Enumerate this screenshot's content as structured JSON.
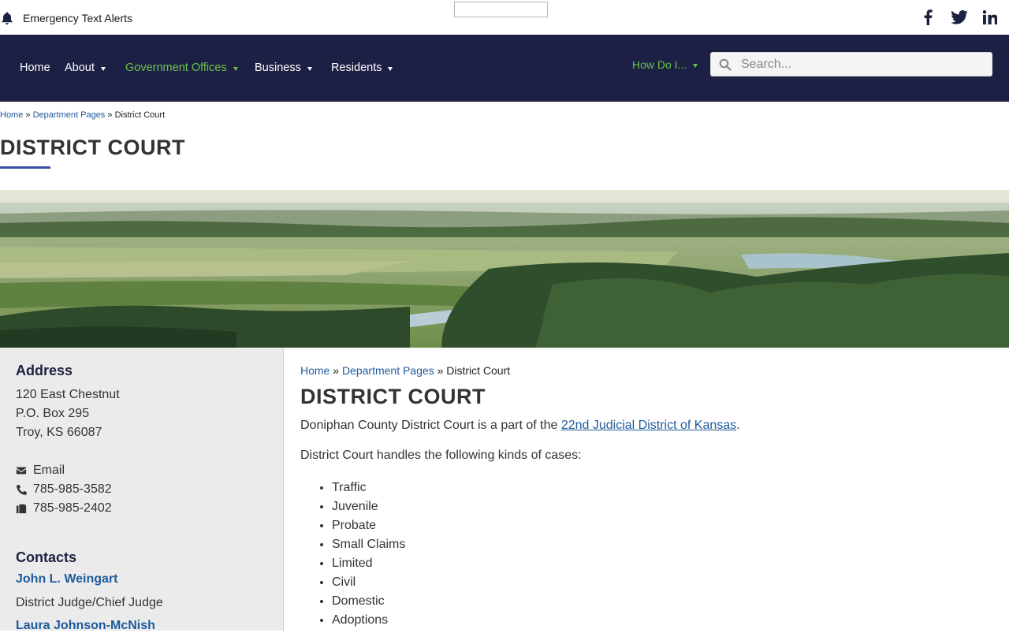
{
  "topbar": {
    "alert_label": "Emergency Text Alerts",
    "social": [
      {
        "icon": "facebook-icon"
      },
      {
        "icon": "twitter-icon"
      },
      {
        "icon": "linkedin-icon"
      }
    ]
  },
  "nav": {
    "items": [
      {
        "label": "Home",
        "has_caret": false,
        "active": false
      },
      {
        "label": "About",
        "has_caret": true,
        "active": false
      },
      {
        "label": "Government Offices",
        "has_caret": true,
        "active": true
      },
      {
        "label": "Business",
        "has_caret": true,
        "active": false
      },
      {
        "label": "Residents",
        "has_caret": true,
        "active": false
      }
    ],
    "howdo_label": "How Do I...",
    "search_placeholder": "Search..."
  },
  "breadcrumb": {
    "home": "Home",
    "dept": "Department Pages",
    "current": "District Court",
    "sep": "»"
  },
  "page_title": "DISTRICT COURT",
  "sidebar": {
    "address_heading": "Address",
    "address_lines": [
      "120 East Chestnut",
      "P.O. Box 295",
      "Troy, KS 66087"
    ],
    "email_label": "Email",
    "phone": "785-985-3582",
    "fax": "785-985-2402",
    "contacts_heading": "Contacts",
    "contacts": [
      {
        "name": "John L. Weingart",
        "role": "District Judge/Chief Judge"
      },
      {
        "name": "Laura Johnson-McNish",
        "role": ""
      }
    ]
  },
  "content": {
    "intro_prefix": "Doniphan County District Court is a part of the ",
    "intro_link": "22nd Judicial District of Kansas",
    "intro_suffix": ".",
    "cases_intro": "District Court handles the following kinds of cases:",
    "cases": [
      "Traffic",
      "Juvenile",
      "Probate",
      "Small Claims",
      "Limited",
      "Civil",
      "Domestic",
      "Adoptions"
    ]
  },
  "colors": {
    "nav_bg": "#1c2044",
    "accent_green": "#6cc24a",
    "link_blue": "#1e5a9c",
    "underline_blue": "#3a4fa0",
    "sidebar_bg": "#ebebeb"
  }
}
